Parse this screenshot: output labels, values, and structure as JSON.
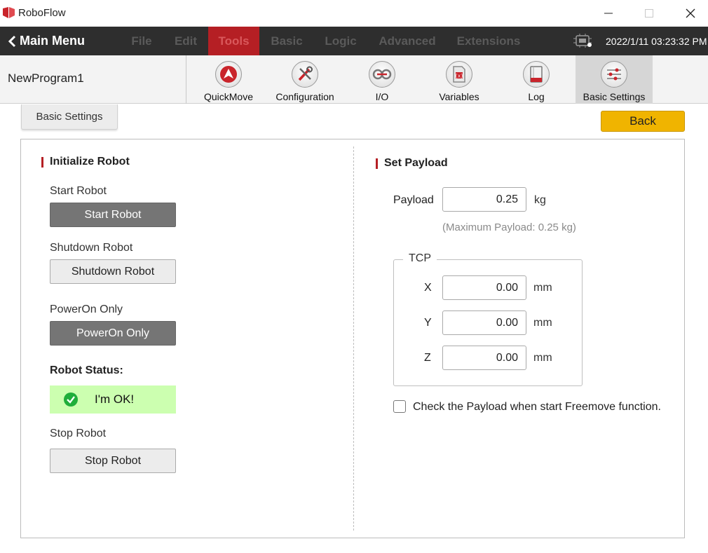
{
  "app": {
    "title": "RoboFlow"
  },
  "menubar": {
    "main_menu": "Main Menu",
    "items": [
      {
        "label": "File",
        "active": false
      },
      {
        "label": "Edit",
        "active": false
      },
      {
        "label": "Tools",
        "active": true
      },
      {
        "label": "Basic",
        "active": false
      },
      {
        "label": "Logic",
        "active": false
      },
      {
        "label": "Advanced",
        "active": false
      },
      {
        "label": "Extensions",
        "active": false
      }
    ],
    "datetime": "2022/1/11 03:23:32 PM"
  },
  "toolbar": {
    "program_name": "NewProgram1",
    "tools": [
      {
        "label": "QuickMove",
        "icon": "quickmove-icon"
      },
      {
        "label": "Configuration",
        "icon": "wrench-screwdriver-icon"
      },
      {
        "label": "I/O",
        "icon": "io-icon"
      },
      {
        "label": "Variables",
        "icon": "variables-icon"
      },
      {
        "label": "Log",
        "icon": "log-book-icon"
      },
      {
        "label": "Basic Settings",
        "icon": "sliders-icon",
        "active": true
      }
    ]
  },
  "content": {
    "tab_label": "Basic Settings",
    "back_label": "Back",
    "init": {
      "title": "Initialize Robot",
      "start_label": "Start Robot",
      "start_button": "Start Robot",
      "shutdown_label": "Shutdown Robot",
      "shutdown_button": "Shutdown Robot",
      "poweron_label": "PowerOn Only",
      "poweron_button": "PowerOn Only",
      "status_label": "Robot Status:",
      "status_text": "I'm OK!",
      "stop_label": "Stop Robot",
      "stop_button": "Stop Robot"
    },
    "payload": {
      "title": "Set Payload",
      "payload_label": "Payload",
      "payload_value": "0.25",
      "payload_unit": "kg",
      "max_hint": "(Maximum Payload: 0.25 kg)",
      "tcp_title": "TCP",
      "tcp": [
        {
          "axis": "X",
          "value": "0.00",
          "unit": "mm"
        },
        {
          "axis": "Y",
          "value": "0.00",
          "unit": "mm"
        },
        {
          "axis": "Z",
          "value": "0.00",
          "unit": "mm"
        }
      ],
      "check_label": "Check the Payload when start Freemove function."
    }
  },
  "colors": {
    "accent_red": "#b51f24",
    "back_yellow": "#f0b400",
    "status_green": "#ccffb0",
    "menubar_bg": "#2e2e2e"
  }
}
